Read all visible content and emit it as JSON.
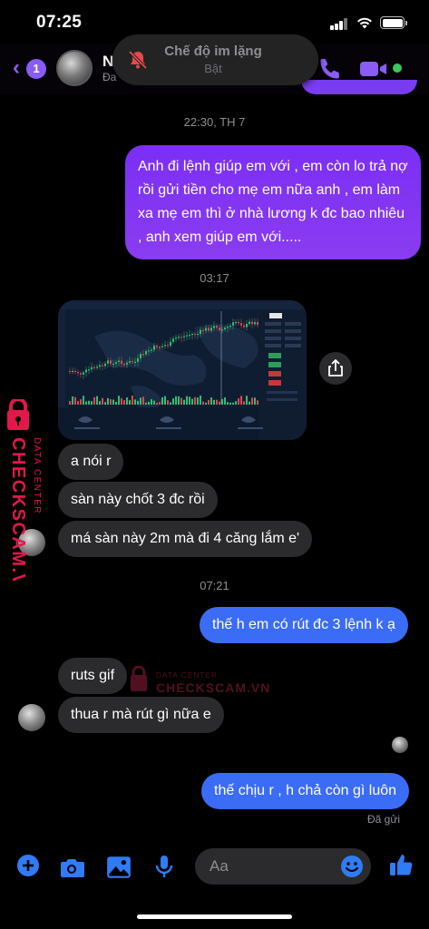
{
  "status_bar": {
    "time": "07:25"
  },
  "header": {
    "back_badge": "1",
    "contact_name": "N",
    "contact_sub": "Đa",
    "silent_mode_title": "Chế độ im lặng",
    "silent_mode_state": "Bật"
  },
  "messages": [
    {
      "type": "timestamp",
      "text": "22:30, TH 7"
    },
    {
      "type": "outgoing",
      "text": "Anh đi lệnh giúp em với , em còn lo trả nợ rồi gửi tiền cho mẹ em nữa anh , em làm xa mẹ em thì ở nhà lương k đc bao nhiêu , anh xem giúp em với....."
    },
    {
      "type": "timestamp",
      "text": "03:17"
    },
    {
      "type": "incoming_image",
      "description": "trading-chart-screenshot"
    },
    {
      "type": "incoming",
      "text": "a nói r"
    },
    {
      "type": "incoming",
      "text": "sàn này chốt 3 đc rồi"
    },
    {
      "type": "incoming",
      "text": "má sàn này 2m mà đi 4 căng lắm e'"
    },
    {
      "type": "timestamp",
      "text": "07:21"
    },
    {
      "type": "outgoing",
      "text": "thế h em có rút đc 3 lệnh k ạ"
    },
    {
      "type": "incoming",
      "text": "ruts gif"
    },
    {
      "type": "incoming",
      "text": "thua r mà rút gì nữa e"
    },
    {
      "type": "outgoing",
      "text": "thế chịu r , h chả còn gì luôn"
    }
  ],
  "delivery_status": "Đã gửi",
  "composer": {
    "placeholder": "Aa"
  },
  "watermark": {
    "brand": "CHECKSCAM.VN",
    "tagline": "DATA CENTER"
  },
  "colors": {
    "outgoing_purple": "#7b2ff5",
    "outgoing_blue": "#3b6cf6",
    "incoming_gray": "#2b2b2d",
    "accent": "#8a5cf6",
    "icon_blue": "#2f7cf6",
    "watermark_red": "#e3174a"
  }
}
